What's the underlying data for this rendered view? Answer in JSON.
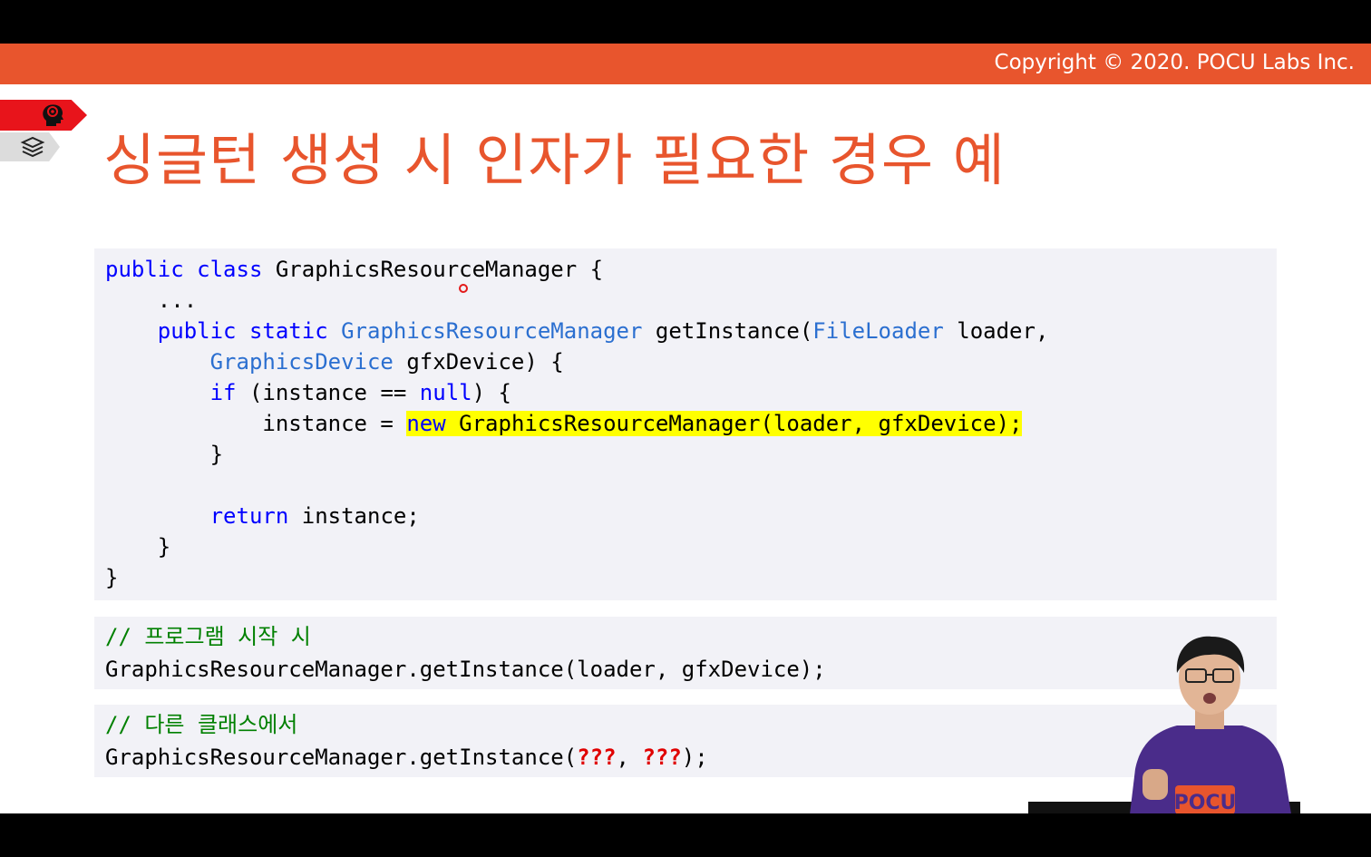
{
  "header": {
    "copyright": "Copyright © 2020. POCU Labs Inc.",
    "accent_color": "#e8552d"
  },
  "side_tabs": [
    {
      "icon": "brain-head-icon",
      "color": "#e8141b"
    },
    {
      "icon": "book-stack-icon",
      "color": "#dcdcdc"
    }
  ],
  "title": "싱글턴 생성 시 인자가 필요한 경우 예",
  "code_main": {
    "l1_kw1": "public",
    "l1_kw2": "class",
    "l1_rest": " GraphicsResourceManager {",
    "l2": "    ...",
    "l3_kw1": "public",
    "l3_kw2": "static",
    "l3_ty1": "GraphicsResourceManager",
    "l3_mid": " getInstance(",
    "l3_ty2": "FileLoader",
    "l3_rest": " loader,",
    "l4_ty": "GraphicsDevice",
    "l4_rest": " gfxDevice) {",
    "l5_kw": "if",
    "l5_mid": " (instance == ",
    "l5_null": "null",
    "l5_rest": ") {",
    "l6_pre": "            instance = ",
    "l6_hl_kw": "new",
    "l6_hl_rest": " GraphicsResourceManager(loader, gfxDevice);",
    "l7": "        }",
    "l9_kw": "return",
    "l9_rest": " instance;",
    "l10": "    }",
    "l11": "}"
  },
  "code_startup": {
    "comment": "// 프로그램 시작 시",
    "line": "GraphicsResourceManager.getInstance(loader, gfxDevice);"
  },
  "code_other": {
    "comment": "// 다른 클래스에서",
    "prefix": "GraphicsResourceManager.getInstance(",
    "q1": "???",
    "sep": ", ",
    "q2": "???",
    "suffix": ");"
  },
  "presenter_shirt": "POCU"
}
